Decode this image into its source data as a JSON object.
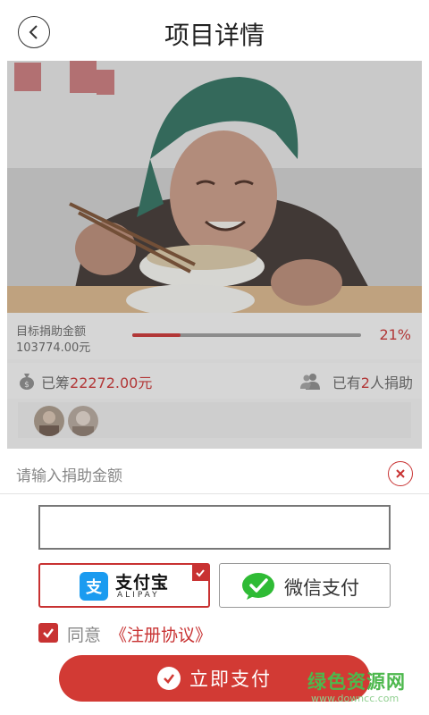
{
  "header": {
    "title": "项目详情"
  },
  "project": {
    "target_label": "目标捐助金额",
    "target_amount": "103774.00元",
    "progress_percent": 21,
    "progress_label": "21%",
    "raised_prefix": "已筹",
    "raised_amount": "22272.00元",
    "donors_prefix": "已有",
    "donors_count": "2",
    "donors_suffix": "人捐助"
  },
  "sheet": {
    "title": "请输入捐助金额",
    "amount_value": "",
    "payment_options": {
      "alipay_name": "支付宝",
      "alipay_sub": "ALIPAY",
      "wechat_label": "微信支付",
      "selected": "alipay"
    },
    "agree_text": "同意",
    "agree_link": "《注册协议》",
    "pay_button": "立即支付"
  },
  "watermark": {
    "text": "绿色资源网",
    "url": "www.downcc.com"
  },
  "colors": {
    "accent": "#c83232",
    "alipay": "#1a9bf0",
    "wechat": "#2fbb35"
  }
}
